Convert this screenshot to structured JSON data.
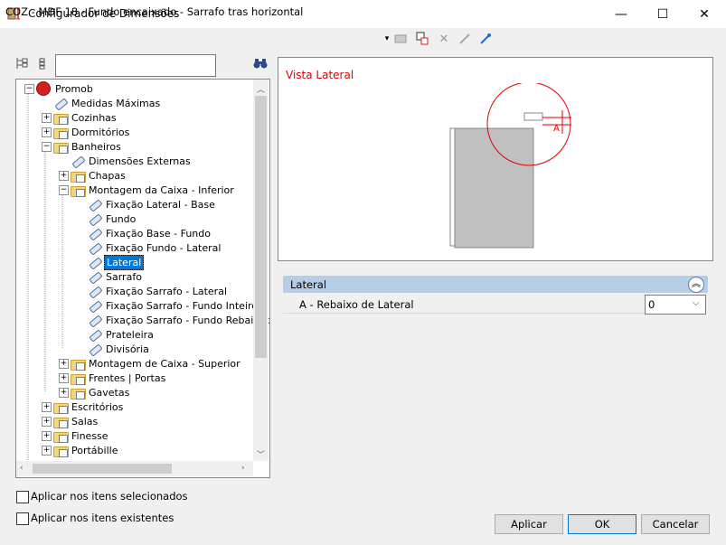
{
  "window": {
    "title": "Configurador de Dimensões",
    "minimize_glyph": "—",
    "maximize_glyph": "☐",
    "close_glyph": "✕"
  },
  "config": {
    "current": "COZ - MDF 18 - Fundo encaixado - Sarrafo tras horizontal",
    "dropdown_glyph": "▾"
  },
  "search": {
    "value": "",
    "placeholder": ""
  },
  "tree": {
    "items": [
      {
        "label": "Promob",
        "level": 0,
        "expander": "−",
        "icon": "root"
      },
      {
        "label": "Medidas Máximas",
        "level": 1,
        "expander": "",
        "icon": "tag"
      },
      {
        "label": "Cozinhas",
        "level": 1,
        "expander": "+",
        "icon": "folder"
      },
      {
        "label": "Dormitórios",
        "level": 1,
        "expander": "+",
        "icon": "folder"
      },
      {
        "label": "Banheiros",
        "level": 1,
        "expander": "−",
        "icon": "folder"
      },
      {
        "label": "Dimensões Externas",
        "level": 2,
        "expander": "",
        "icon": "tag"
      },
      {
        "label": "Chapas",
        "level": 2,
        "expander": "+",
        "icon": "folder"
      },
      {
        "label": "Montagem da Caixa - Inferior",
        "level": 2,
        "expander": "−",
        "icon": "folder"
      },
      {
        "label": "Fixação Lateral - Base",
        "level": 3,
        "expander": "",
        "icon": "tag"
      },
      {
        "label": "Fundo",
        "level": 3,
        "expander": "",
        "icon": "tag"
      },
      {
        "label": "Fixação Base - Fundo",
        "level": 3,
        "expander": "",
        "icon": "tag"
      },
      {
        "label": "Fixação Fundo - Lateral",
        "level": 3,
        "expander": "",
        "icon": "tag"
      },
      {
        "label": "Lateral",
        "level": 3,
        "expander": "",
        "icon": "tag",
        "selected": true
      },
      {
        "label": "Sarrafo",
        "level": 3,
        "expander": "",
        "icon": "tag"
      },
      {
        "label": "Fixação Sarrafo - Lateral",
        "level": 3,
        "expander": "",
        "icon": "tag"
      },
      {
        "label": "Fixação Sarrafo - Fundo Inteiro",
        "level": 3,
        "expander": "",
        "icon": "tag"
      },
      {
        "label": "Fixação Sarrafo - Fundo Rebaixado",
        "level": 3,
        "expander": "",
        "icon": "tag"
      },
      {
        "label": "Prateleira",
        "level": 3,
        "expander": "",
        "icon": "tag"
      },
      {
        "label": "Divisória",
        "level": 3,
        "expander": "",
        "icon": "tag"
      },
      {
        "label": "Montagem de Caixa - Superior",
        "level": 2,
        "expander": "+",
        "icon": "folder"
      },
      {
        "label": "Frentes | Portas",
        "level": 2,
        "expander": "+",
        "icon": "folder"
      },
      {
        "label": "Gavetas",
        "level": 2,
        "expander": "+",
        "icon": "folder"
      },
      {
        "label": "Escritórios",
        "level": 1,
        "expander": "+",
        "icon": "folder"
      },
      {
        "label": "Salas",
        "level": 1,
        "expander": "+",
        "icon": "folder"
      },
      {
        "label": "Finesse",
        "level": 1,
        "expander": "+",
        "icon": "folder"
      },
      {
        "label": "Portábille",
        "level": 1,
        "expander": "+",
        "icon": "folder"
      }
    ]
  },
  "options": {
    "apply_selected": "Aplicar nos itens selecionados",
    "apply_existing": "Aplicar nos itens existentes"
  },
  "preview": {
    "title": "Vista Lateral",
    "dimension_label": "A",
    "accent_color": "#e00000"
  },
  "properties": {
    "section_title": "Lateral",
    "collapse_glyph": "︽",
    "row_label": "A - Rebaixo de Lateral",
    "row_value": "0",
    "dropdown_glyph": "⌵"
  },
  "buttons": {
    "apply": "Aplicar",
    "ok": "OK",
    "cancel": "Cancelar"
  },
  "icons": [
    "app-icon",
    "dropdown-icon",
    "copy-icon",
    "paste-icon",
    "delete-icon",
    "import-icon",
    "export-icon",
    "expand-all-icon",
    "collapse-all-icon",
    "binoculars-icon"
  ]
}
